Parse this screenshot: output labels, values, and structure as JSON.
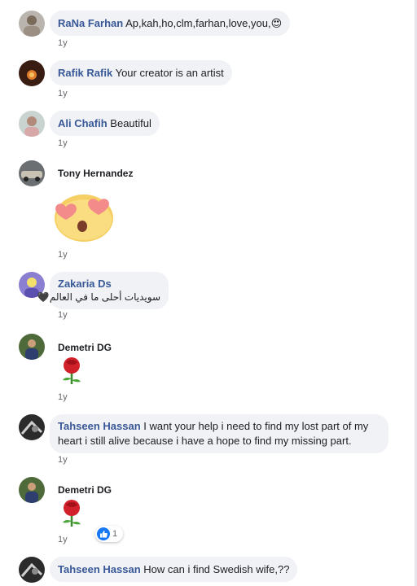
{
  "comments": [
    {
      "name": "RaNa Farhan",
      "text": "Ap,kah,ho,clm,farhan,love,you,",
      "emoji": "😍",
      "time": "1y"
    },
    {
      "name": "Rafik Rafik",
      "text": "Your creator is an artist",
      "time": "1y"
    },
    {
      "name": "Ali Chafih",
      "text": "Beautiful",
      "time": "1y"
    },
    {
      "name": "Tony Hernandez",
      "sticker": "heart-eyes-sticker",
      "time": "1y"
    },
    {
      "name": "Zakaria Ds",
      "text": "سويديات أحلى ما في العالم",
      "emoji": "🖤",
      "time": "1y"
    },
    {
      "name": "Demetri DG",
      "sticker": "rose",
      "time": "1y"
    },
    {
      "name": "Tahseen Hassan",
      "text": "I want your help i need to find my lost part of my heart i still alive because i have a hope to find my missing part.",
      "time": "1y"
    },
    {
      "name": "Demetri DG",
      "sticker": "rose",
      "time": "1y",
      "reaction": {
        "icon": "like-icon",
        "count": "1"
      }
    },
    {
      "name": "Tahseen Hassan",
      "text": "How can i find Swedish wife,??"
    }
  ],
  "colors": {
    "name": "#385898",
    "bubble": "#f0f2f5",
    "time": "#65676b",
    "like": "#1877f2"
  }
}
